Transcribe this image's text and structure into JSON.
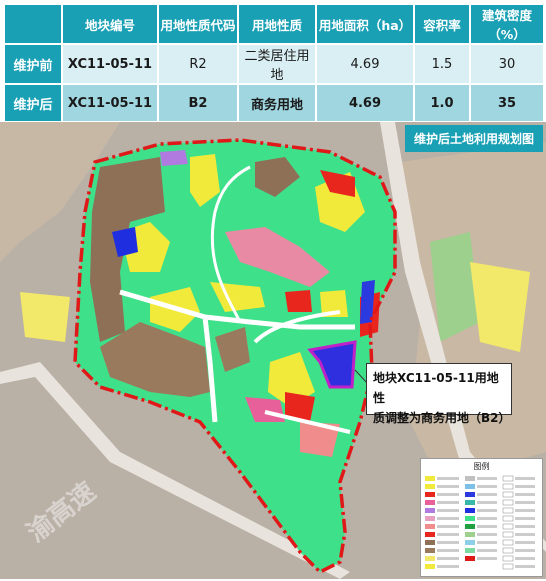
{
  "table": {
    "headers": [
      "",
      "地块编号",
      "用地性质代码",
      "用地性质",
      "用地面积（ha）",
      "容积率",
      "建筑密度（%）"
    ],
    "rows": [
      {
        "label": "维护前",
        "code": "XC11-05-11",
        "use_code": "R2",
        "use": "二类居住用地",
        "area": "4.69",
        "far": "1.5",
        "density": "30"
      },
      {
        "label": "维护后",
        "code": "XC11-05-11",
        "use_code": "B2",
        "use": "商务用地",
        "area": "4.69",
        "far": "1.0",
        "density": "35"
      }
    ]
  },
  "map": {
    "title": "维护后土地利用规划图",
    "callout": [
      "地块XC11-05-11用地性",
      "质调整为商务用地（B2）"
    ],
    "watermark": "渝高速",
    "legend_title": "图例"
  }
}
